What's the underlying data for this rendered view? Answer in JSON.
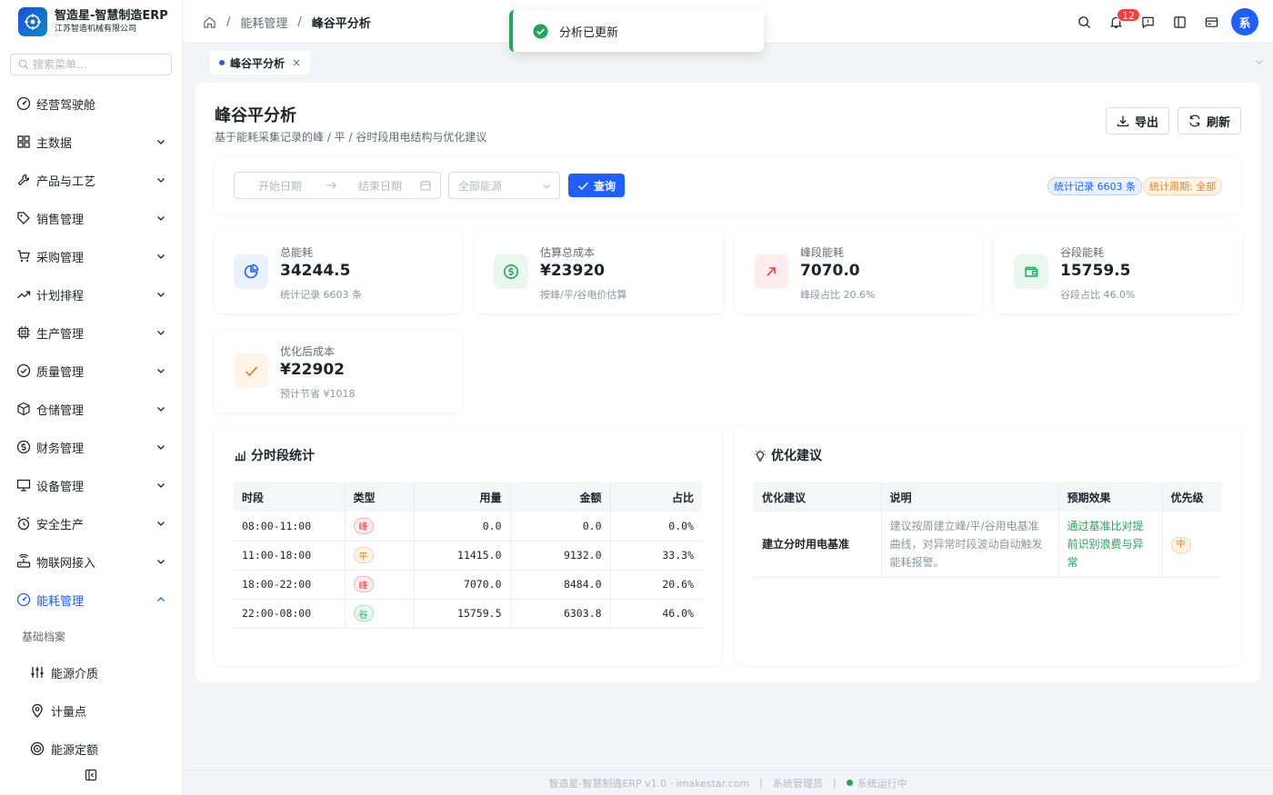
{
  "brand": {
    "title": "智造星-智慧制造ERP",
    "subtitle": "江苏智造机械有限公司"
  },
  "sidebar": {
    "search_placeholder": "搜索菜单...",
    "items": [
      {
        "label": "经营驾驶舱",
        "icon": "dashboard-icon"
      },
      {
        "label": "主数据",
        "icon": "grid-icon"
      },
      {
        "label": "产品与工艺",
        "icon": "tool-icon"
      },
      {
        "label": "销售管理",
        "icon": "tag-icon"
      },
      {
        "label": "采购管理",
        "icon": "cart-icon"
      },
      {
        "label": "计划排程",
        "icon": "trend-icon"
      },
      {
        "label": "生产管理",
        "icon": "chip-icon"
      },
      {
        "label": "质量管理",
        "icon": "check-circle-icon"
      },
      {
        "label": "仓储管理",
        "icon": "box-icon"
      },
      {
        "label": "财务管理",
        "icon": "dollar-icon"
      },
      {
        "label": "设备管理",
        "icon": "monitor-icon"
      },
      {
        "label": "安全生产",
        "icon": "alarm-icon"
      },
      {
        "label": "物联网接入",
        "icon": "router-icon"
      },
      {
        "label": "能耗管理",
        "icon": "gauge-icon"
      }
    ],
    "group_label": "基础档案",
    "sub_items": [
      {
        "label": "能源介质",
        "icon": "sliders-icon"
      },
      {
        "label": "计量点",
        "icon": "location-icon"
      },
      {
        "label": "能源定额",
        "icon": "target-icon"
      }
    ]
  },
  "header": {
    "breadcrumb": [
      "能耗管理",
      "峰谷平分析"
    ],
    "notification_count": "12",
    "avatar": "系"
  },
  "toast": {
    "message": "分析已更新"
  },
  "tab": {
    "label": "峰谷平分析",
    "close": "×"
  },
  "page": {
    "title": "峰谷平分析",
    "subtitle": "基于能耗采集记录的峰 / 平 / 谷时段用电结构与优化建议",
    "export_label": "导出",
    "refresh_label": "刷新"
  },
  "filter": {
    "start_placeholder": "开始日期",
    "end_placeholder": "结束日期",
    "energy_placeholder": "全部能源",
    "query_label": "查询",
    "tag_records": "统计记录 6603 条",
    "tag_period": "统计周期: 全部"
  },
  "kpis": [
    {
      "label": "总能耗",
      "value": "34244.5",
      "sub": "统计记录 6603 条"
    },
    {
      "label": "估算总成本",
      "value": "¥23920",
      "sub": "按峰/平/谷电价估算"
    },
    {
      "label": "峰段能耗",
      "value": "7070.0",
      "sub": "峰段占比 20.6%"
    },
    {
      "label": "谷段能耗",
      "value": "15759.5",
      "sub": "谷段占比 46.0%"
    },
    {
      "label": "优化后成本",
      "value": "¥22902",
      "sub": "预计节省 ¥1018"
    }
  ],
  "colors": {
    "accent": "#1f5eff",
    "success": "#1fa855",
    "danger": "#e84040",
    "warning": "#e8841a"
  },
  "period_table": {
    "title": "分时段统计",
    "headers": [
      "时段",
      "类型",
      "用量",
      "金额",
      "占比"
    ],
    "rows": [
      {
        "period": "08:00-11:00",
        "type": "峰",
        "usage": "0.0",
        "amount": "0.0",
        "ratio": "0.0%"
      },
      {
        "period": "11:00-18:00",
        "type": "平",
        "usage": "11415.0",
        "amount": "9132.0",
        "ratio": "33.3%"
      },
      {
        "period": "18:00-22:00",
        "type": "峰",
        "usage": "7070.0",
        "amount": "8484.0",
        "ratio": "20.6%"
      },
      {
        "period": "22:00-08:00",
        "type": "谷",
        "usage": "15759.5",
        "amount": "6303.8",
        "ratio": "46.0%"
      }
    ]
  },
  "suggestions": {
    "title": "优化建议",
    "headers": [
      "优化建议",
      "说明",
      "预期效果",
      "优先级"
    ],
    "rows": [
      {
        "name": "建立分时用电基准",
        "desc": "建议按周建立峰/平/谷用电基准曲线，对异常时段波动自动触发能耗报警。",
        "effect": "通过基准比对提前识别浪费与异常",
        "priority": "中"
      }
    ]
  },
  "footer": {
    "copyright": "智造星-智慧制造ERP v1.0 · imakestar.com",
    "user": "系统管理员",
    "status": "系统运行中"
  }
}
